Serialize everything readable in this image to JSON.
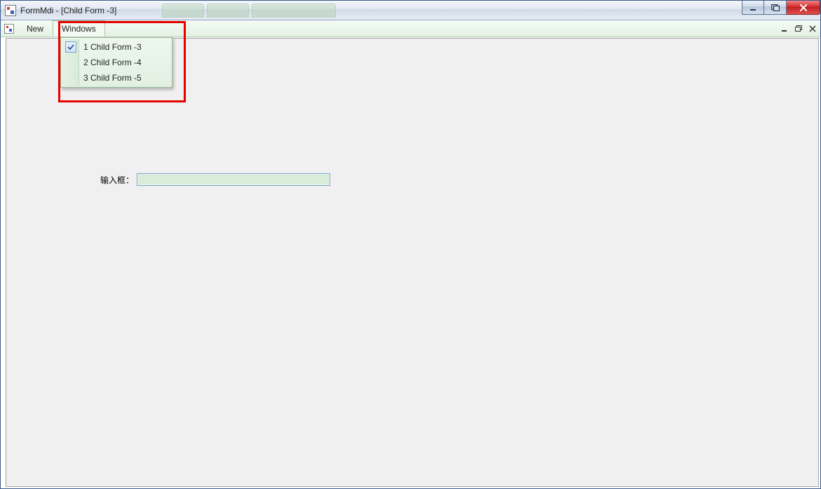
{
  "window": {
    "title": "FormMdi - [Child Form -3]"
  },
  "menu": {
    "new_label": "New",
    "windows_label": "Windows"
  },
  "windows_menu": {
    "items": [
      {
        "label": "1 Child Form -3",
        "checked": true
      },
      {
        "label": "2 Child Form -4",
        "checked": false
      },
      {
        "label": "3 Child Form -5",
        "checked": false
      }
    ]
  },
  "form": {
    "input_label": "输入框：",
    "input_value": ""
  }
}
